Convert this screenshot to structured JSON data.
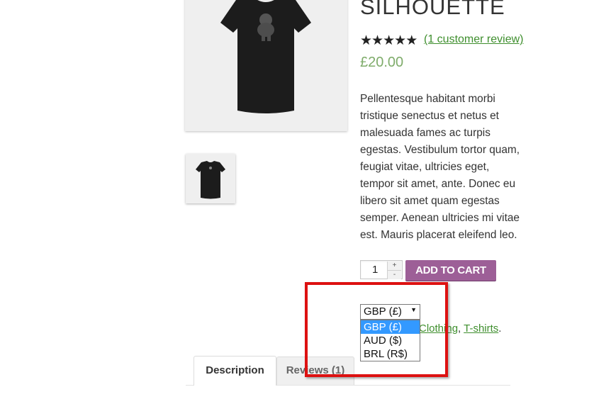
{
  "product": {
    "title": "SILHOUETTE",
    "rating_stars": 5,
    "review_link": "(1 customer review)",
    "price": "£20.00",
    "description": "Pellentesque habitant morbi tristique senectus et netus et malesuada fames ac turpis egestas. Vestibulum tortor quam, feugiat vitae, ultricies eget, tempor sit amet, ante. Donec eu libero sit amet quam egestas semper. Aenean ultricies mi vitae est. Mauris placerat eleifend leo."
  },
  "cart": {
    "quantity": "1",
    "plus": "+",
    "minus": "-",
    "add_to_cart": "ADD TO CART"
  },
  "currency": {
    "selected": "GBP (£)",
    "options": [
      "GBP (£)",
      "AUD ($)",
      "BRL (R$)"
    ]
  },
  "meta": {
    "categories": [
      "Clothing",
      "T-shirts"
    ],
    "separator": ", ",
    "end": "."
  },
  "tabs": {
    "description": "Description",
    "reviews": "Reviews (1)"
  },
  "colors": {
    "button": "#9d5f97",
    "link": "#3f8f2e",
    "price": "#7fac6b",
    "highlight": "#dd1111",
    "option_selected": "#3399ff"
  }
}
